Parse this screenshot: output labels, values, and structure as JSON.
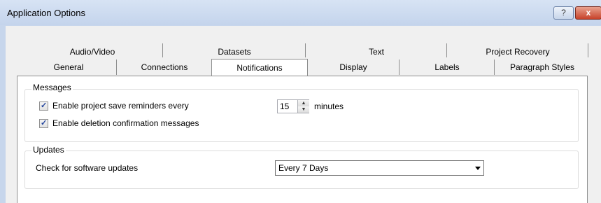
{
  "window": {
    "title": "Application Options",
    "help_label": "?",
    "close_label": "x"
  },
  "tabs": {
    "back_row": [
      {
        "label": "Audio/Video"
      },
      {
        "label": "Datasets"
      },
      {
        "label": "Text"
      },
      {
        "label": "Project Recovery"
      }
    ],
    "front_row": [
      {
        "label": "General"
      },
      {
        "label": "Connections"
      },
      {
        "label": "Notifications",
        "selected": true
      },
      {
        "label": "Display"
      },
      {
        "label": "Labels"
      },
      {
        "label": "Paragraph Styles"
      }
    ]
  },
  "messages": {
    "legend": "Messages",
    "save_reminder_label": "Enable project save reminders every",
    "save_reminder_checked": true,
    "minutes_value": "15",
    "minutes_label": "minutes",
    "deletion_label": "Enable deletion confirmation messages",
    "deletion_checked": true
  },
  "updates": {
    "legend": "Updates",
    "check_label": "Check for software updates",
    "selected_option": "Every 7 Days"
  },
  "colors": {
    "title_bar": "#c4d4ec",
    "close_button": "#c7422a",
    "check_mark": "#21439c"
  },
  "icons": {
    "checkbox": "check-mark-icon",
    "spin": "spin-arrows-icon",
    "dropdown": "chevron-down-icon"
  }
}
